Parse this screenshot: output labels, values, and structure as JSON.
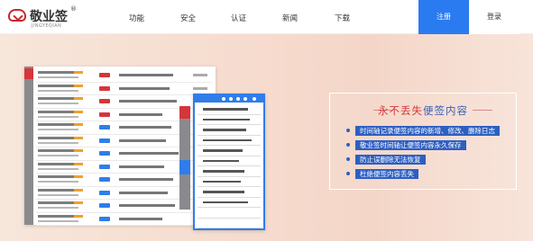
{
  "logo": {
    "name": "敬业签",
    "registered": "®",
    "pinyin": "JINGYEQIAN"
  },
  "nav": [
    "功能",
    "安全",
    "认证",
    "新闻",
    "下载"
  ],
  "auth": {
    "register": "注册",
    "login": "登录"
  },
  "feature_card": {
    "title_red": "永不丢失",
    "title_blue": "便签内容",
    "features": [
      "时间轴记录便签内容的新增、修改、删除日志",
      "敬业签时间轴让便签内容永久保存",
      "防止误删除无法恢复",
      "杜绝便签内容丢失"
    ]
  },
  "colors": {
    "brand_red": "#c9272f",
    "primary_blue": "#2b7bf0",
    "feature_blue": "#2d5fc2"
  }
}
